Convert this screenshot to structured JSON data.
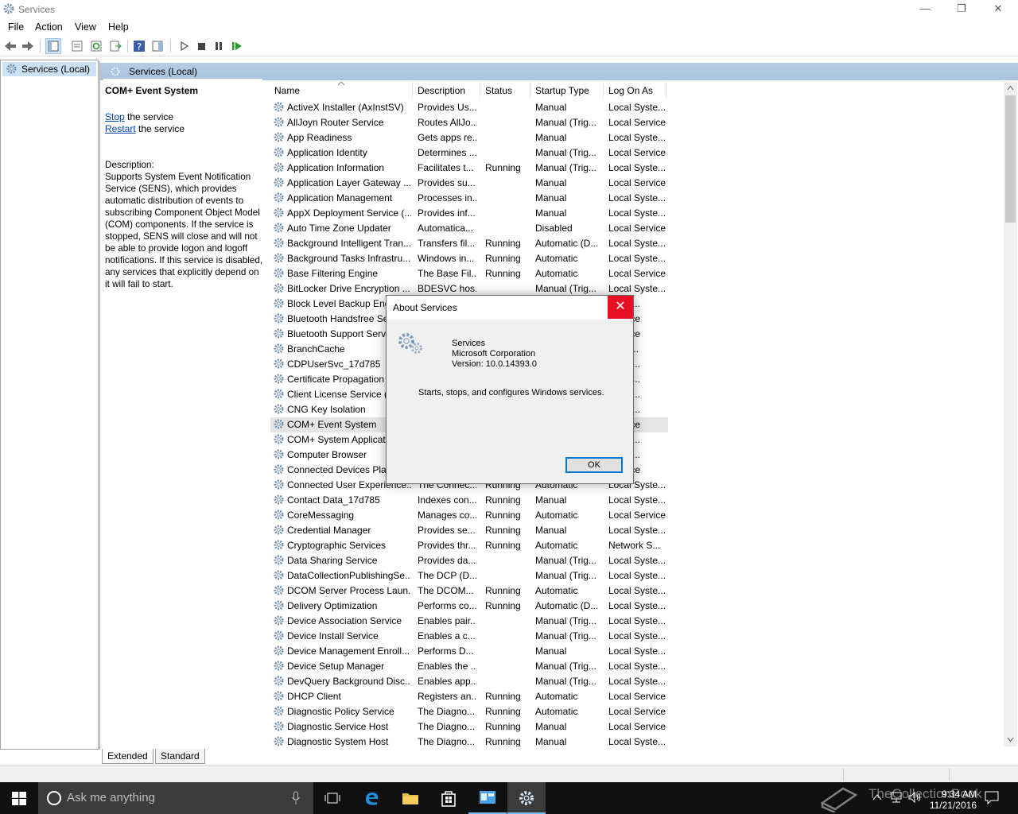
{
  "window": {
    "title": "Services"
  },
  "menu": [
    "File",
    "Action",
    "View",
    "Help"
  ],
  "tree": {
    "root": "Services (Local)"
  },
  "panel": {
    "header": "Services (Local)"
  },
  "extended": {
    "service_name": "COM+ Event System",
    "stop_link": "Stop",
    "stop_text": " the service",
    "restart_link": "Restart",
    "restart_text": " the service",
    "description_label": "Description:",
    "description": "Supports System Event Notification Service (SENS), which provides automatic distribution of events to subscribing Component Object Model (COM) components. If the service is stopped, SENS will close and will not be able to provide logon and logoff notifications. If this service is disabled, any services that explicitly depend on it will fail to start."
  },
  "columns": [
    "Name",
    "Description",
    "Status",
    "Startup Type",
    "Log On As"
  ],
  "services": [
    [
      "ActiveX Installer (AxInstSV)",
      "Provides Us...",
      "",
      "Manual",
      "Local Syste..."
    ],
    [
      "AllJoyn Router Service",
      "Routes AllJo...",
      "",
      "Manual (Trig...",
      "Local Service"
    ],
    [
      "App Readiness",
      "Gets apps re...",
      "",
      "Manual",
      "Local Syste..."
    ],
    [
      "Application Identity",
      "Determines ...",
      "",
      "Manual (Trig...",
      "Local Service"
    ],
    [
      "Application Information",
      "Facilitates t...",
      "Running",
      "Manual (Trig...",
      "Local Syste..."
    ],
    [
      "Application Layer Gateway ...",
      "Provides su...",
      "",
      "Manual",
      "Local Service"
    ],
    [
      "Application Management",
      "Processes in...",
      "",
      "Manual",
      "Local Syste..."
    ],
    [
      "AppX Deployment Service (...",
      "Provides inf...",
      "",
      "Manual",
      "Local Syste..."
    ],
    [
      "Auto Time Zone Updater",
      "Automatica...",
      "",
      "Disabled",
      "Local Service"
    ],
    [
      "Background Intelligent Tran...",
      "Transfers fil...",
      "Running",
      "Automatic (D...",
      "Local Syste..."
    ],
    [
      "Background Tasks Infrastru...",
      "Windows in...",
      "Running",
      "Automatic",
      "Local Syste..."
    ],
    [
      "Base Filtering Engine",
      "The Base Fil...",
      "Running",
      "Automatic",
      "Local Service"
    ],
    [
      "BitLocker Drive Encryption ...",
      "BDESVC hos...",
      "",
      "Manual (Trig...",
      "Local Syste..."
    ],
    [
      "Block Level Backup Eng",
      "",
      "",
      "",
      "Syste..."
    ],
    [
      "Bluetooth Handsfree Se",
      "",
      "",
      "",
      "Service"
    ],
    [
      "Bluetooth Support Servi",
      "",
      "",
      "",
      "Service"
    ],
    [
      "BranchCache",
      "",
      "",
      "",
      "ork S..."
    ],
    [
      "CDPUserSvc_17d785",
      "",
      "",
      "",
      "Syste..."
    ],
    [
      "Certificate Propagation",
      "",
      "",
      "",
      "Syste..."
    ],
    [
      "Client License Service (C",
      "",
      "",
      "",
      "Syste..."
    ],
    [
      "CNG Key Isolation",
      "",
      "",
      "",
      "Syste..."
    ],
    [
      "COM+ Event System",
      "",
      "",
      "",
      "Service"
    ],
    [
      "COM+ System Applicat",
      "",
      "",
      "",
      "Syste..."
    ],
    [
      "Computer Browser",
      "",
      "",
      "",
      "Syste..."
    ],
    [
      "Connected Devices Plat",
      "",
      "",
      "",
      "Service"
    ],
    [
      "Connected User Experience...",
      "The Connec...",
      "Running",
      "Automatic",
      "Local Syste..."
    ],
    [
      "Contact Data_17d785",
      "Indexes con...",
      "Running",
      "Manual",
      "Local Syste..."
    ],
    [
      "CoreMessaging",
      "Manages co...",
      "Running",
      "Automatic",
      "Local Service"
    ],
    [
      "Credential Manager",
      "Provides se...",
      "Running",
      "Manual",
      "Local Syste..."
    ],
    [
      "Cryptographic Services",
      "Provides thr...",
      "Running",
      "Automatic",
      "Network S..."
    ],
    [
      "Data Sharing Service",
      "Provides da...",
      "",
      "Manual (Trig...",
      "Local Syste..."
    ],
    [
      "DataCollectionPublishingSe...",
      "The DCP (D...",
      "",
      "Manual (Trig...",
      "Local Syste..."
    ],
    [
      "DCOM Server Process Laun...",
      "The DCOM...",
      "Running",
      "Automatic",
      "Local Syste..."
    ],
    [
      "Delivery Optimization",
      "Performs co...",
      "Running",
      "Automatic (D...",
      "Local Syste..."
    ],
    [
      "Device Association Service",
      "Enables pair...",
      "",
      "Manual (Trig...",
      "Local Syste..."
    ],
    [
      "Device Install Service",
      "Enables a c...",
      "",
      "Manual (Trig...",
      "Local Syste..."
    ],
    [
      "Device Management Enroll...",
      "Performs D...",
      "",
      "Manual",
      "Local Syste..."
    ],
    [
      "Device Setup Manager",
      "Enables the ...",
      "",
      "Manual (Trig...",
      "Local Syste..."
    ],
    [
      "DevQuery Background Disc...",
      "Enables app...",
      "",
      "Manual (Trig...",
      "Local Syste..."
    ],
    [
      "DHCP Client",
      "Registers an...",
      "Running",
      "Automatic",
      "Local Service"
    ],
    [
      "Diagnostic Policy Service",
      "The Diagno...",
      "Running",
      "Automatic",
      "Local Service"
    ],
    [
      "Diagnostic Service Host",
      "The Diagno...",
      "Running",
      "Manual",
      "Local Service"
    ],
    [
      "Diagnostic System Host",
      "The Diagno...",
      "Running",
      "Manual",
      "Local Syste..."
    ]
  ],
  "selected_service": "COM+ Event System",
  "tabs": [
    "Extended",
    "Standard"
  ],
  "dialog": {
    "title": "About Services",
    "close": "✕",
    "product": "Services",
    "company": "Microsoft Corporation",
    "version": "Version: 10.0.14393.0",
    "blurb": "Starts, stops, and configures Windows services.",
    "ok": "OK"
  },
  "taskbar": {
    "search_placeholder": "Ask me anything",
    "time": "9:34 AM",
    "date": "11/21/2016",
    "watermark": "TheCollectionBook"
  },
  "colors": {
    "accent": "#0078d7",
    "close_red": "#e81123",
    "header_blue": "#b6cde3",
    "taskbar": "#101010"
  }
}
